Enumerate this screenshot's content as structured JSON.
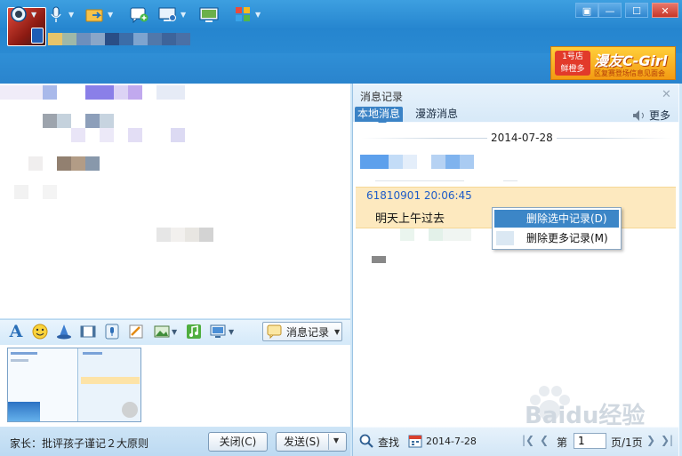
{
  "window": {
    "controls": [
      "▣",
      "—",
      "☐",
      "✕"
    ]
  },
  "advert": {
    "shop_text": "1号店\n鲜橙多",
    "brand_text": "漫友C-Girl",
    "sub_text": "区复赛登场信息见面会"
  },
  "toolbar": {
    "icons": [
      "webcam-icon",
      "microphone-icon",
      "file-transfer-icon",
      "add-chat-icon",
      "screen-share-icon",
      "remote-desktop-icon",
      "apps-icon"
    ]
  },
  "edit_toolbar": {
    "font_icon": "A",
    "message_record_label": "消息记录"
  },
  "bottom": {
    "parent_link": "家长：批评孩子谨记２大原则",
    "close_label": "关闭(C)",
    "send_label": "发送(S)"
  },
  "history": {
    "title": "消息记录",
    "tab_local": "本地消息",
    "tab_roam": "漫游消息",
    "more": "更多",
    "date": "2014-07-28",
    "message": {
      "sender_time": "61810901 20:06:45",
      "text": "明天上午过去"
    },
    "context_menu": {
      "delete_selected": "删除选中记录(D)",
      "delete_more": "删除更多记录(M)"
    },
    "footer": {
      "search": "查找",
      "date_filter": "2014-7-28",
      "page_prefix": "第",
      "page_value": "1",
      "page_suffix": "页/1页"
    }
  },
  "watermark": "Baidu经验"
}
